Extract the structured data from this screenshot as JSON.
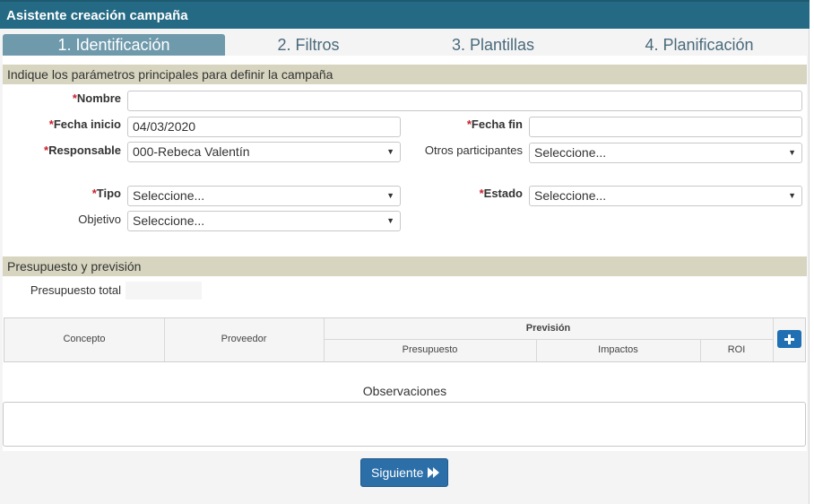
{
  "window": {
    "title": "Asistente creación campaña"
  },
  "steps": [
    {
      "label": "1. Identificación",
      "active": true
    },
    {
      "label": "2. Filtros",
      "active": false
    },
    {
      "label": "3. Plantillas",
      "active": false
    },
    {
      "label": "4. Planificación",
      "active": false
    }
  ],
  "identification": {
    "section_title": "Indique los parámetros principales para definir la campaña",
    "required_mark": "*",
    "nombre": {
      "label": "Nombre",
      "value": ""
    },
    "fecha_inicio": {
      "label": "Fecha inicio",
      "value": "04/03/2020"
    },
    "fecha_fin": {
      "label": "Fecha fin",
      "value": ""
    },
    "responsable": {
      "label": "Responsable",
      "value": "000-Rebeca Valentín"
    },
    "otros_participantes": {
      "label": "Otros participantes",
      "value": "Seleccione..."
    },
    "tipo": {
      "label": "Tipo",
      "value": "Seleccione..."
    },
    "estado": {
      "label": "Estado",
      "value": "Seleccione..."
    },
    "objetivo": {
      "label": "Objetivo",
      "value": "Seleccione..."
    }
  },
  "budget": {
    "section_title": "Presupuesto y previsión",
    "total_label": "Presupuesto total",
    "total_value": "",
    "table": {
      "col_concepto": "Concepto",
      "col_proveedor": "Proveedor",
      "group_prevision": "Previsión",
      "col_presupuesto": "Presupuesto",
      "col_impactos": "Impactos",
      "col_roi": "ROI"
    }
  },
  "observaciones": {
    "label": "Observaciones",
    "value": ""
  },
  "footer": {
    "next_label": "Siguiente"
  },
  "icons": {
    "add": "plus-icon",
    "next": "fast-forward-icon",
    "dropdown": "caret-down-icon"
  },
  "colors": {
    "titlebar": "#256a84",
    "section": "#d7d5bf",
    "active_step": "#6f9aac",
    "button": "#2b6ea8",
    "required": "#c8202a"
  }
}
